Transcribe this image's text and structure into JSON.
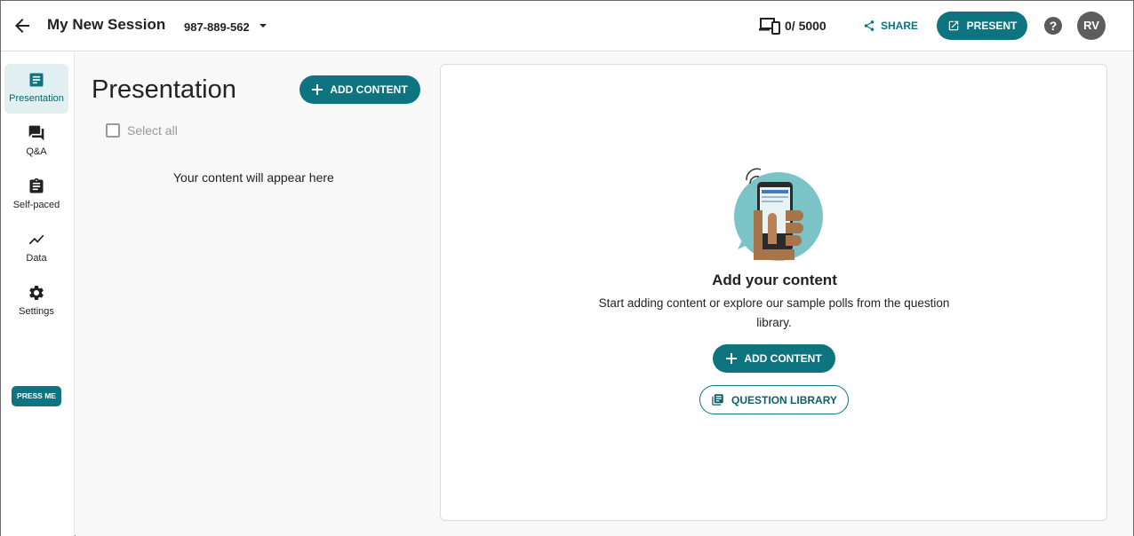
{
  "header": {
    "back_icon": "arrow-left-icon",
    "session_title": "My New Session",
    "session_code": "987-889-562",
    "device_count": "0/ 5000",
    "share_label": "SHARE",
    "present_label": "PRESENT",
    "help_label": "?",
    "avatar_initials": "RV"
  },
  "sidebar": {
    "items": [
      {
        "label": "Presentation",
        "icon": "presentation-icon",
        "active": true
      },
      {
        "label": "Q&A",
        "icon": "forum-icon",
        "active": false
      },
      {
        "label": "Self-paced",
        "icon": "clipboard-icon",
        "active": false
      },
      {
        "label": "Data",
        "icon": "trend-line-icon",
        "active": false
      },
      {
        "label": "Settings",
        "icon": "gear-icon",
        "active": false
      }
    ],
    "press_me_label": "PRESS ME"
  },
  "left_panel": {
    "heading": "Presentation",
    "add_content_label": "ADD CONTENT",
    "select_all_label": "Select all",
    "empty_note": "Your content will appear here"
  },
  "card": {
    "title": "Add your content",
    "description": "Start adding content or explore our sample polls from the question library.",
    "add_content_label": "ADD CONTENT",
    "question_library_label": "QUESTION LIBRARY"
  },
  "colors": {
    "accent": "#0e7480",
    "active_nav_bg": "#e3f0f1",
    "panel_bg": "#f8f8f8"
  }
}
